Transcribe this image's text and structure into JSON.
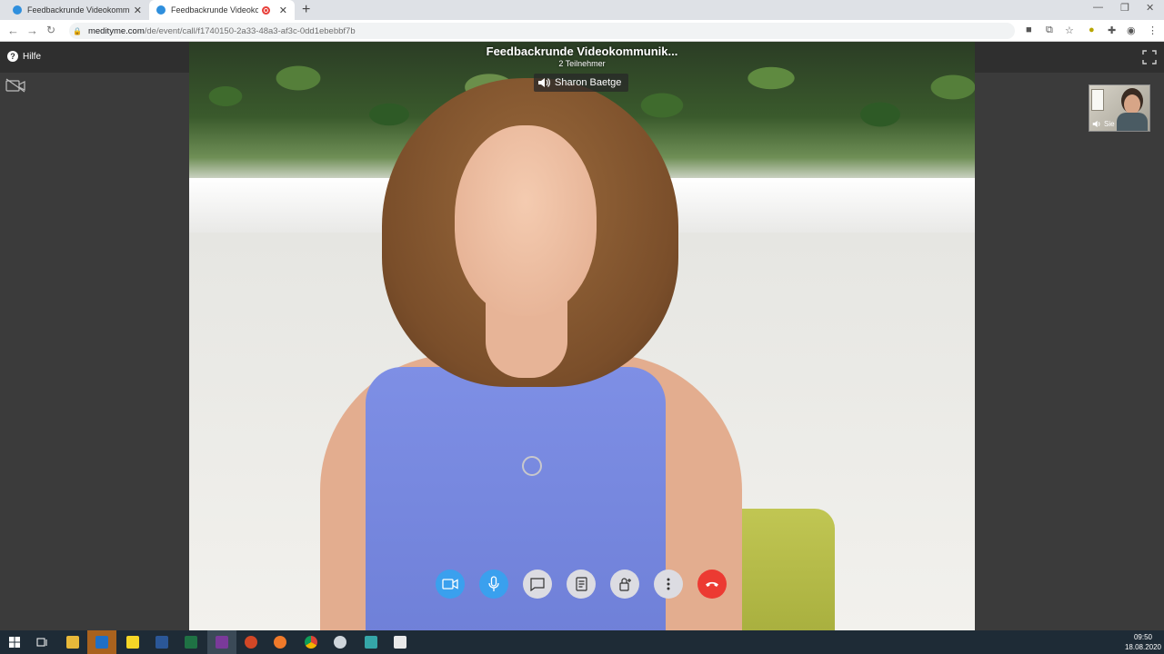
{
  "browser": {
    "tabs": [
      {
        "title": "Feedbackrunde Videokommunik",
        "active": false
      },
      {
        "title": "Feedbackrunde Videokomm",
        "active": true,
        "recording": true
      }
    ],
    "new_tab_label": "+",
    "url_host": "medityme.com",
    "url_path": "/de/event/call/f1740150-2a33-48a3-af3c-0dd1ebebbf7b"
  },
  "app": {
    "help_label": "Hilfe",
    "call_title": "Feedbackrunde Videokommunik...",
    "participants": "2 Teilnehmer",
    "active_speaker": "Sharon Baetge",
    "self_label": "Sie"
  },
  "controls": [
    {
      "name": "camera-toggle-button",
      "icon": "video-camera-icon",
      "style": "blue"
    },
    {
      "name": "microphone-toggle-button",
      "icon": "microphone-icon",
      "style": "blue"
    },
    {
      "name": "chat-button",
      "icon": "chat-bubble-icon",
      "style": "grey"
    },
    {
      "name": "notes-button",
      "icon": "document-icon",
      "style": "grey"
    },
    {
      "name": "lock-button",
      "icon": "lock-plus-icon",
      "style": "grey"
    },
    {
      "name": "more-options-button",
      "icon": "more-vertical-icon",
      "style": "grey"
    },
    {
      "name": "hang-up-button",
      "icon": "phone-hangup-icon",
      "style": "red"
    }
  ],
  "taskbar": {
    "time": "09:50",
    "date": "18.08.2020"
  },
  "colors": {
    "control_blue": "#3aa0ee",
    "control_grey": "#dcdce2",
    "hangup_red": "#ec3a32",
    "app_bg": "#3b3b3b",
    "taskbar_bg": "#1e2b36"
  }
}
